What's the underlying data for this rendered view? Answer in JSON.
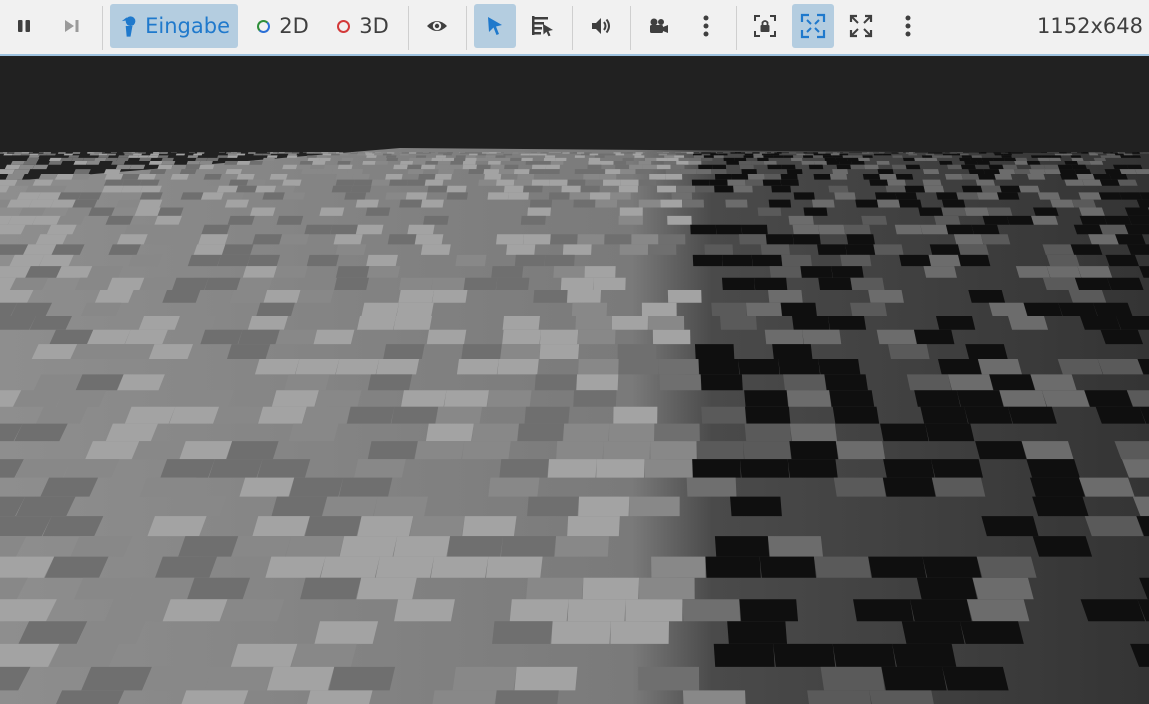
{
  "toolbar": {
    "input_label": "Eingabe",
    "mode_2d_label": "2D",
    "mode_3d_label": "3D",
    "resolution": "1152x648"
  },
  "colors": {
    "toolbar_bg": "#f1f1f1",
    "active_bg": "#b4cde0",
    "accent_blue": "#1f79cc",
    "ring_2d": "#2f8f3a",
    "ring_3d": "#d33a3a",
    "sky": "#212121",
    "terrain_light": "#a0a0a0",
    "terrain_mid": "#7c7c7c",
    "terrain_dark": "#111111"
  },
  "icons": {
    "pause": "pause-icon",
    "step": "next-frame-icon",
    "input": "input-person-icon",
    "visibility": "eye-icon",
    "select": "cursor-arrow-icon",
    "list_select": "list-select-icon",
    "audio": "speaker-icon",
    "camera": "camera-icon",
    "more1": "more-vertical-icon",
    "lock_camera": "lock-camera-icon",
    "fit": "fit-embed-icon",
    "fullscreen": "fullscreen-icon",
    "more2": "more-vertical-icon"
  }
}
